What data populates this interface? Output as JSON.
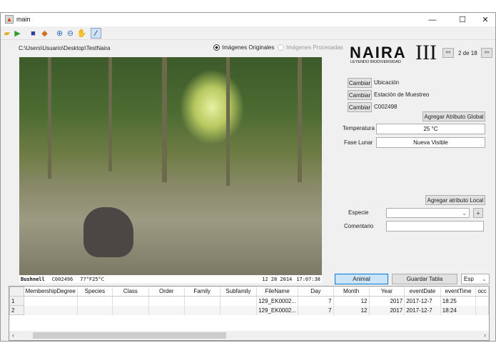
{
  "window": {
    "title": "main"
  },
  "toolbar": {
    "icons": [
      "open-folder-icon",
      "play-icon",
      "save-icon",
      "book-icon",
      "zoom-in-icon",
      "zoom-out-icon",
      "pan-hand-icon",
      "data-cursor-icon"
    ]
  },
  "path": "C:\\Users\\Usuario\\Desktop\\TestNaira",
  "radios": {
    "original": "Imágenes Originales",
    "processed": "Imágenes Procesadas"
  },
  "logo": {
    "name": "NAIRA",
    "numeral": "III",
    "tagline": "LEYENDO BIODIVERSIDAD"
  },
  "nav": {
    "prev": "<<",
    "next": ">>",
    "page": "2 de 18"
  },
  "attributes": [
    {
      "button": "Cambiar",
      "value": "Ubicación"
    },
    {
      "button": "Cambiar",
      "value": "Estación de Muestreo"
    },
    {
      "button": "Cambiar",
      "value": "C002498"
    }
  ],
  "global_button": "Agregar Atributo Global",
  "temperatura": {
    "label": "Temperatura",
    "value": "25 °C"
  },
  "fase": {
    "label": "Fase Lunar",
    "value": "Nueva Visible"
  },
  "local_button": "Agregar atributo Local",
  "especie": {
    "label": "Especie",
    "value": "",
    "add": "+"
  },
  "comentario": {
    "label": "Comentario",
    "value": ""
  },
  "photo_strip": {
    "brand": "Bushnell",
    "camera": "C002496",
    "temp": "77°F25°C",
    "date": "12 28 2014",
    "time": "17:07:38"
  },
  "buttons": {
    "animal": "Animal",
    "guardar": "Guardar Tabla",
    "lang": "Esp"
  },
  "table": {
    "columns": [
      "MembershipDegree",
      "Species",
      "Class",
      "Order",
      "Family",
      "Subfamily",
      "FileName",
      "Day",
      "Month",
      "Year",
      "eventDate",
      "eventTime",
      "occ"
    ],
    "rows": [
      {
        "id": "1",
        "cells": [
          "",
          "",
          "",
          "",
          "",
          "",
          "129_EK0002...",
          "7",
          "12",
          "2017",
          "2017-12-7",
          "18:25",
          ""
        ]
      },
      {
        "id": "2",
        "cells": [
          "",
          "",
          "",
          "",
          "",
          "",
          "129_EK0002...",
          "7",
          "12",
          "2017",
          "2017-12-7",
          "18:24",
          ""
        ]
      }
    ]
  }
}
